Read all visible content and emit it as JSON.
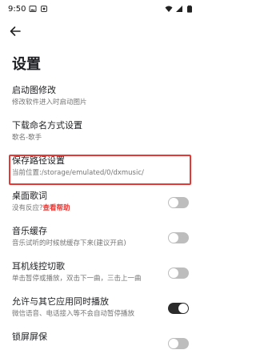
{
  "status_bar": {
    "time": "9:50",
    "icons": [
      "image-icon",
      "notification-icon",
      "wifi-icon",
      "signal-icon",
      "battery-icon"
    ]
  },
  "toolbar": {
    "back_icon": "arrow-left-icon"
  },
  "page": {
    "title": "设置"
  },
  "settings": [
    {
      "title": "启动图修改",
      "subtitle": "修改软件进入时启动图片"
    },
    {
      "title": "下载命名方式设置",
      "subtitle": "歌名-歌手"
    },
    {
      "title": "保存路径设置",
      "subtitle": "当前位置:/storage/emulated/0/dxmusic/",
      "highlighted": true
    },
    {
      "title": "桌面歌词",
      "subtitle": "没有反应?",
      "help_link": "查看帮助",
      "toggle": false
    },
    {
      "title": "音乐缓存",
      "subtitle": "音乐试听的时候就缓存下来(建议开启)",
      "toggle": false
    },
    {
      "title": "耳机线控切歌",
      "subtitle": "单击暂停或播放，双击下一曲，三击上一曲",
      "toggle": false
    },
    {
      "title": "允许与其它应用同时播放",
      "subtitle": "微信语音、电话接入等不会自动暂停播放",
      "toggle": true
    },
    {
      "title": "锁屏屏保",
      "subtitle": "",
      "toggle": false
    }
  ],
  "colors": {
    "highlight_border": "#e53935",
    "help_link": "#e53935",
    "toggle_on": "#2b2b2b",
    "toggle_off": "#bdbdbd"
  }
}
